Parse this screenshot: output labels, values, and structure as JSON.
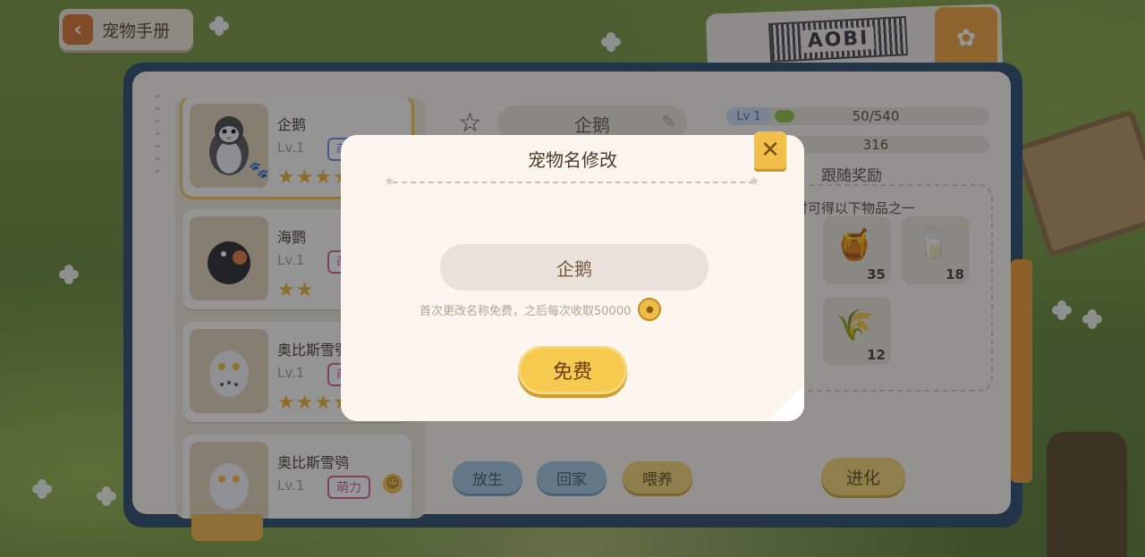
{
  "header": {
    "back_label": "宠物手册",
    "tag_text": "AOBI"
  },
  "pet_list": [
    {
      "name": "企鹅",
      "level": "Lv.1",
      "type": "萌力",
      "stars": "★★★★"
    },
    {
      "name": "海鹦",
      "level": "Lv.1",
      "type": "萌力",
      "stars": "★★"
    },
    {
      "name": "奥比斯雪鸮",
      "level": "Lv.1",
      "type": "萌力",
      "stars": "★★★★"
    },
    {
      "name": "奥比斯雪鸮",
      "level": "Lv.1",
      "type": "萌力",
      "stars": ""
    }
  ],
  "detail": {
    "name": "企鹅",
    "level_badge": "1",
    "level_progress": 0.09,
    "exp_text": "50/540",
    "stat_text": "316",
    "reward_title": "跟随奖励",
    "reward_hint": "时可得以下物品之一",
    "rewards": [
      {
        "icon": "honeycomb-icon",
        "qty": "35"
      },
      {
        "icon": "glass-icon",
        "qty": "18"
      },
      {
        "icon": "wheat-bundle-icon",
        "qty": "12"
      }
    ],
    "actions": {
      "release": "放生",
      "home": "回家",
      "feed": "喂养",
      "evolve": "进化"
    }
  },
  "modal": {
    "title": "宠物名修改",
    "input_value": "企鹅",
    "hint": "首次更改名称免费，之后每次收取50000",
    "confirm_label": "免费"
  },
  "colors": {
    "accent": "#f2c04a",
    "panel": "#fdf6ee",
    "book_border": "#2e4e6b"
  }
}
